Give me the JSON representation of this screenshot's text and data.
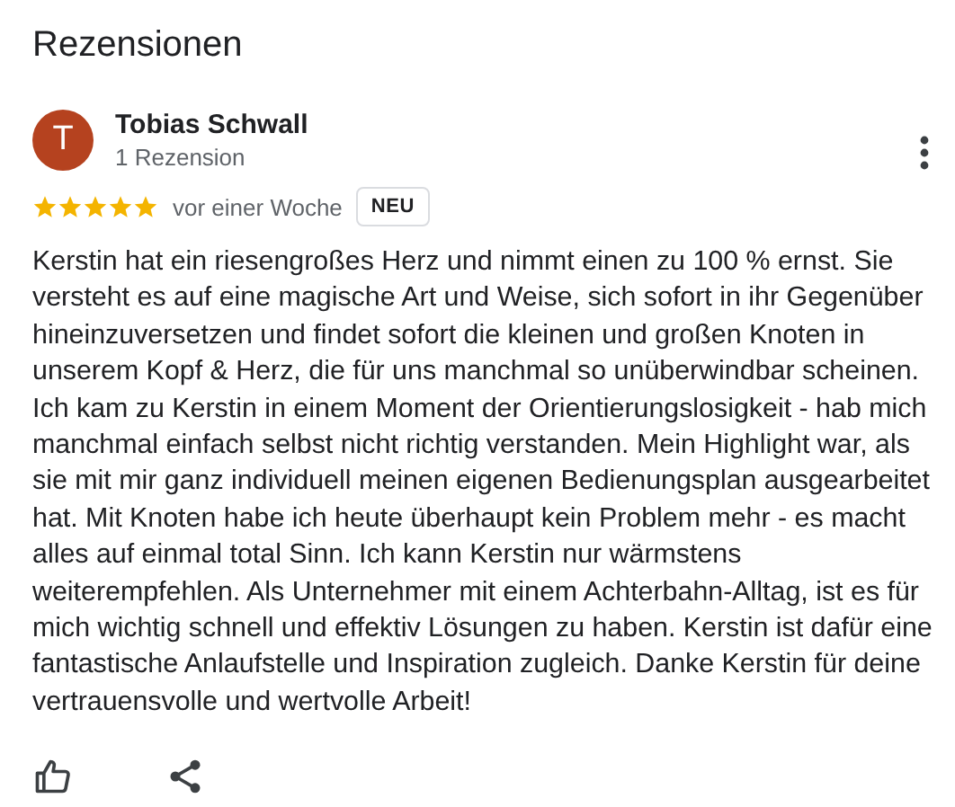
{
  "heading": "Rezensionen",
  "review": {
    "avatar_letter": "T",
    "author": "Tobias Schwall",
    "author_meta": "1 Rezension",
    "stars": 5,
    "time": "vor einer Woche",
    "badge": "NEU",
    "text": "Kerstin hat ein riesengroßes Herz und nimmt einen zu 100 % ernst. Sie versteht es auf eine magische Art und Weise, sich sofort in ihr Gegenüber hineinzuversetzen und findet sofort die kleinen und großen Knoten in unserem Kopf & Herz, die für uns manchmal so unüberwindbar scheinen. Ich kam zu Kerstin in einem Moment der Orientierungslosigkeit - hab mich manchmal einfach selbst nicht richtig verstanden. Mein Highlight war, als sie mit mir ganz individuell meinen eigenen Bedienungsplan ausgearbeitet hat. Mit Knoten habe ich heute überhaupt kein Problem mehr - es macht alles auf einmal total Sinn. Ich kann Kerstin nur wärmstens weiterempfehlen. Als Unternehmer mit einem Achterbahn-Alltag, ist es für mich wichtig schnell und effektiv Lösungen zu haben. Kerstin ist dafür eine fantastische Anlaufstelle und Inspiration zugleich. Danke Kerstin für deine vertrauensvolle und wertvolle Arbeit!"
  }
}
